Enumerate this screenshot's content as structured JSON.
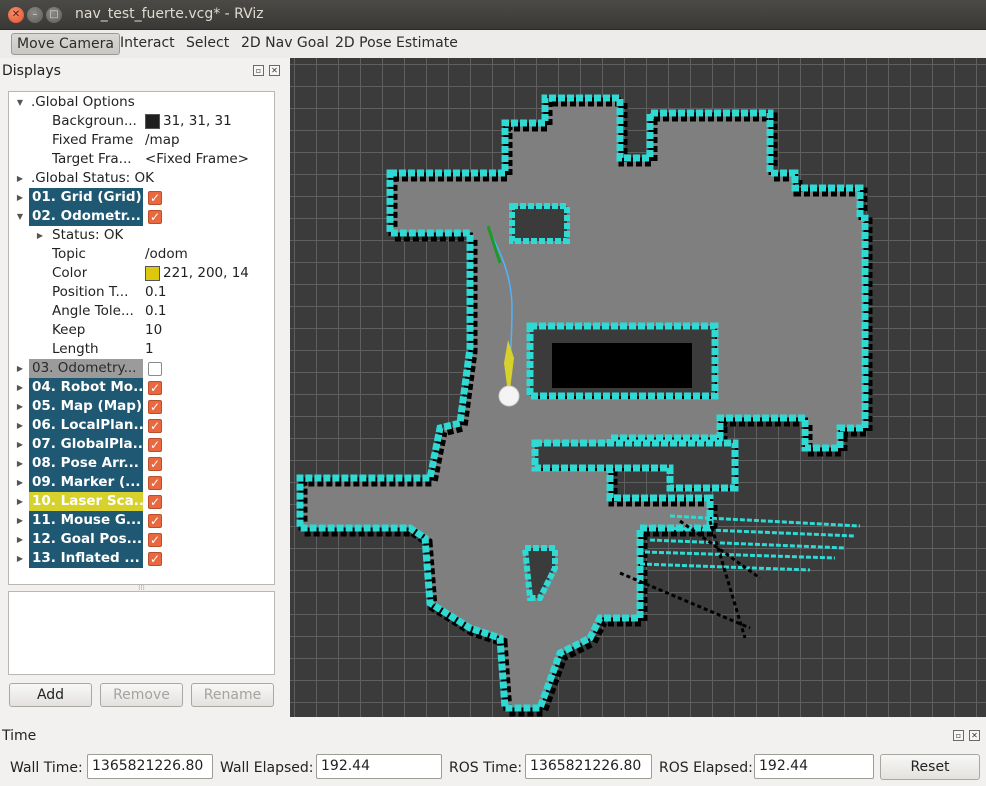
{
  "window": {
    "title": "nav_test_fuerte.vcg* - RViz",
    "close_glyph": "✕",
    "min_glyph": "–",
    "max_glyph": "□"
  },
  "toolbar": {
    "tools": [
      "Move Camera",
      "Interact",
      "Select",
      "2D Nav Goal",
      "2D Pose Estimate"
    ],
    "active": "Move Camera"
  },
  "displays": {
    "title": "Displays",
    "global_options": {
      "label": ".Global Options",
      "background_label": "Backgroun...",
      "background_value": "31, 31, 31",
      "background_color": "#1f1f1f",
      "fixed_frame_label": "Fixed Frame",
      "fixed_frame_value": "/map",
      "target_frame_label": "Target Fra...",
      "target_frame_value": "<Fixed Frame>"
    },
    "global_status": ".Global Status: OK",
    "items": [
      {
        "label": "01. Grid (Grid)",
        "checked": true,
        "style": "blue"
      },
      {
        "label": "02. Odometr...",
        "checked": true,
        "style": "blue",
        "expanded": true
      },
      {
        "label": "03. Odometry...",
        "checked": false,
        "style": "gray"
      },
      {
        "label": "04. Robot Mo...",
        "checked": true,
        "style": "blue"
      },
      {
        "label": "05. Map (Map)",
        "checked": true,
        "style": "blue"
      },
      {
        "label": "06. LocalPlan...",
        "checked": true,
        "style": "blue"
      },
      {
        "label": "07. GlobalPla...",
        "checked": true,
        "style": "blue"
      },
      {
        "label": "08. Pose Arr...",
        "checked": true,
        "style": "blue"
      },
      {
        "label": "09. Marker (...",
        "checked": true,
        "style": "blue"
      },
      {
        "label": "10. Laser Sca...",
        "checked": true,
        "style": "yellow"
      },
      {
        "label": "11. Mouse G...",
        "checked": true,
        "style": "blue"
      },
      {
        "label": "12. Goal Pos...",
        "checked": true,
        "style": "blue"
      },
      {
        "label": "13. Inflated ...",
        "checked": true,
        "style": "blue"
      }
    ],
    "odometry_props": {
      "status": "Status: OK",
      "topic_label": "Topic",
      "topic_value": "/odom",
      "color_label": "Color",
      "color_value": "221, 200, 14",
      "color_hex": "#ddc80e",
      "position_label": "Position T...",
      "position_value": "0.1",
      "angle_label": "Angle Tole...",
      "angle_value": "0.1",
      "keep_label": "Keep",
      "keep_value": "10",
      "length_label": "Length",
      "length_value": "1"
    },
    "buttons": {
      "add": "Add",
      "remove": "Remove",
      "rename": "Rename"
    }
  },
  "time": {
    "title": "Time",
    "wall_time_label": "Wall Time:",
    "wall_time_value": "1365821226.80",
    "wall_elapsed_label": "Wall Elapsed:",
    "wall_elapsed_value": "192.44",
    "ros_time_label": "ROS Time:",
    "ros_time_value": "1365821226.80",
    "ros_elapsed_label": "ROS Elapsed:",
    "ros_elapsed_value": "192.44",
    "reset_label": "Reset"
  },
  "colors": {
    "map_free": "#7f7f7f",
    "map_occupied": "#000000",
    "inflated": "#2fd9d4",
    "selection": "#1f5872",
    "laser": "#d6d12c",
    "grid_background": "#3b3b3b"
  }
}
